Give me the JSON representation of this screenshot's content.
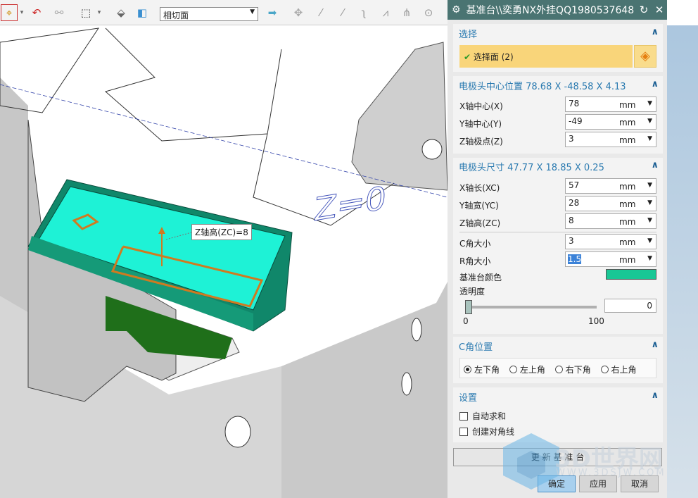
{
  "toolbar": {
    "filter_value": "相切面",
    "icons": [
      "snap-filter-icon",
      "undo-point-icon",
      "binoculars-icon",
      "rect-select-icon",
      "solid-box-icon",
      "cube-view-icon",
      "arrow-right-icon",
      "snap-points-icon",
      "line-endpoint-icon",
      "midpoint-icon",
      "curve-icon",
      "polyline-icon",
      "intersection-icon",
      "circle-center-icon"
    ]
  },
  "viewport": {
    "tooltip": "Z轴高(ZC)=8",
    "annotation": "Z=0",
    "base_color": "#19c795"
  },
  "dialog": {
    "title": "基准台\\\\奕勇NX外挂QQ1980537648",
    "select": {
      "header": "选择",
      "item": "选择面 (2)"
    },
    "center": {
      "header": "电极头中心位置 78.68 X -48.58 X 4.13",
      "rows": [
        {
          "label": "X轴中心(X)",
          "value": "78",
          "unit": "mm"
        },
        {
          "label": "Y轴中心(Y)",
          "value": "-49",
          "unit": "mm"
        },
        {
          "label": "Z轴极点(Z)",
          "value": "3",
          "unit": "mm"
        }
      ]
    },
    "size": {
      "header": "电极头尺寸 47.77 X 18.85 X 0.25",
      "rows": [
        {
          "label": "X轴长(XC)",
          "value": "57",
          "unit": "mm"
        },
        {
          "label": "Y轴宽(YC)",
          "value": "28",
          "unit": "mm"
        },
        {
          "label": "Z轴高(ZC)",
          "value": "8",
          "unit": "mm"
        },
        {
          "label": "C角大小",
          "value": "3",
          "unit": "mm"
        },
        {
          "label": "R角大小",
          "value": "1.5",
          "unit": "mm"
        }
      ],
      "color_label": "基准台颜色",
      "color": "#19c795",
      "transparency_label": "透明度",
      "transparency_value": "0",
      "slider_min": "0",
      "slider_max": "100",
      "slider_level": 0
    },
    "corner": {
      "header": "C角位置",
      "options": [
        "左下角",
        "左上角",
        "右下角",
        "右上角"
      ],
      "selected": 0
    },
    "settings": {
      "header": "设置",
      "options": [
        {
          "label": "自动求和",
          "checked": false
        },
        {
          "label": "创建对角线",
          "checked": false
        }
      ]
    },
    "update_button": "更 新 基 准 台",
    "ok": "确定",
    "apply": "应用",
    "cancel": "取消"
  },
  "watermark": {
    "text": "3D世界网",
    "url": "WWW.3DSJW.COM"
  }
}
